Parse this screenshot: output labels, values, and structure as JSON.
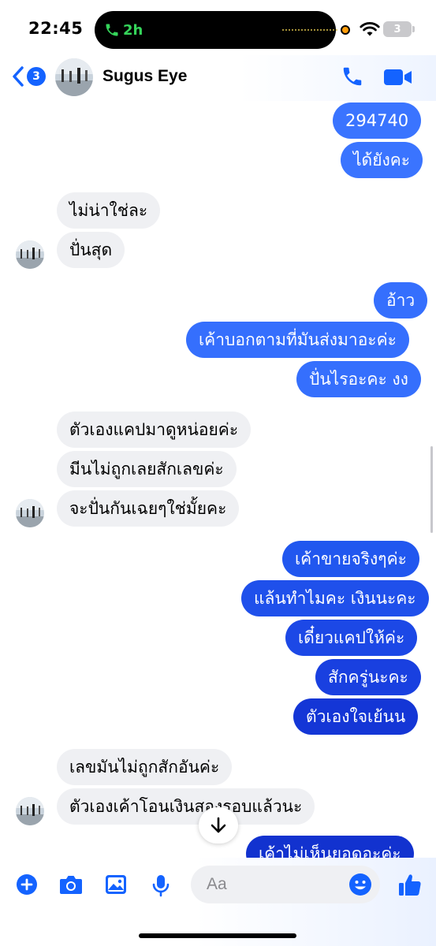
{
  "status_bar": {
    "time": "22:45",
    "call_duration": "2h",
    "battery_level": "3"
  },
  "header": {
    "back_badge": "3",
    "contact_name": "Sugus Eye"
  },
  "colors": {
    "accent": "#1463ff",
    "bubble_top": "#3a74ff",
    "bubble_mid": "#245cf2",
    "bubble_bottom": "#1436d6",
    "incoming_bubble": "#eff0f3"
  },
  "messages": [
    {
      "direction": "out",
      "text": "294740"
    },
    {
      "direction": "out",
      "text": "ได้ยังคะ"
    },
    {
      "direction": "in",
      "text": "ไม่น่าใช่ละ"
    },
    {
      "direction": "in",
      "text": "ปั่นสุด"
    },
    {
      "direction": "out",
      "text": "อ้าว"
    },
    {
      "direction": "out",
      "text": "เค้าบอกตามที่มันส่งมาอะค่ะ"
    },
    {
      "direction": "out",
      "text": "ปั่นไรอะคะ งง"
    },
    {
      "direction": "in",
      "text": "ตัวเองแคปมาดูหน่อยค่ะ"
    },
    {
      "direction": "in",
      "text": "มีนไม่ถูกเลยสักเลขค่ะ"
    },
    {
      "direction": "in",
      "text": "จะปั่นกันเฉยๆใช่มั้ยคะ"
    },
    {
      "direction": "out",
      "text": "เค้าขายจริงๆค่ะ"
    },
    {
      "direction": "out",
      "text": "แล้นทำไมคะ เงินนะคะ"
    },
    {
      "direction": "out",
      "text": "เดี๋ยวแคปให้ค่ะ"
    },
    {
      "direction": "out",
      "text": "สักครู่นะคะ"
    },
    {
      "direction": "out",
      "text": "ตัวเองใจเย้นน"
    },
    {
      "direction": "in",
      "text": "เลขมันไม่ถูกสักอันค่ะ"
    },
    {
      "direction": "in",
      "text": "ตัวเองเค้าโอนเงินสองรอบแล้วนะ"
    },
    {
      "direction": "out",
      "text": "เค้าไม่เห็นยอดอะค่ะ"
    }
  ],
  "composer": {
    "placeholder": "Aa",
    "icons": [
      "plus-icon",
      "camera-icon",
      "image-icon",
      "microphone-icon",
      "emoji-icon",
      "thumbs-up-icon"
    ]
  }
}
